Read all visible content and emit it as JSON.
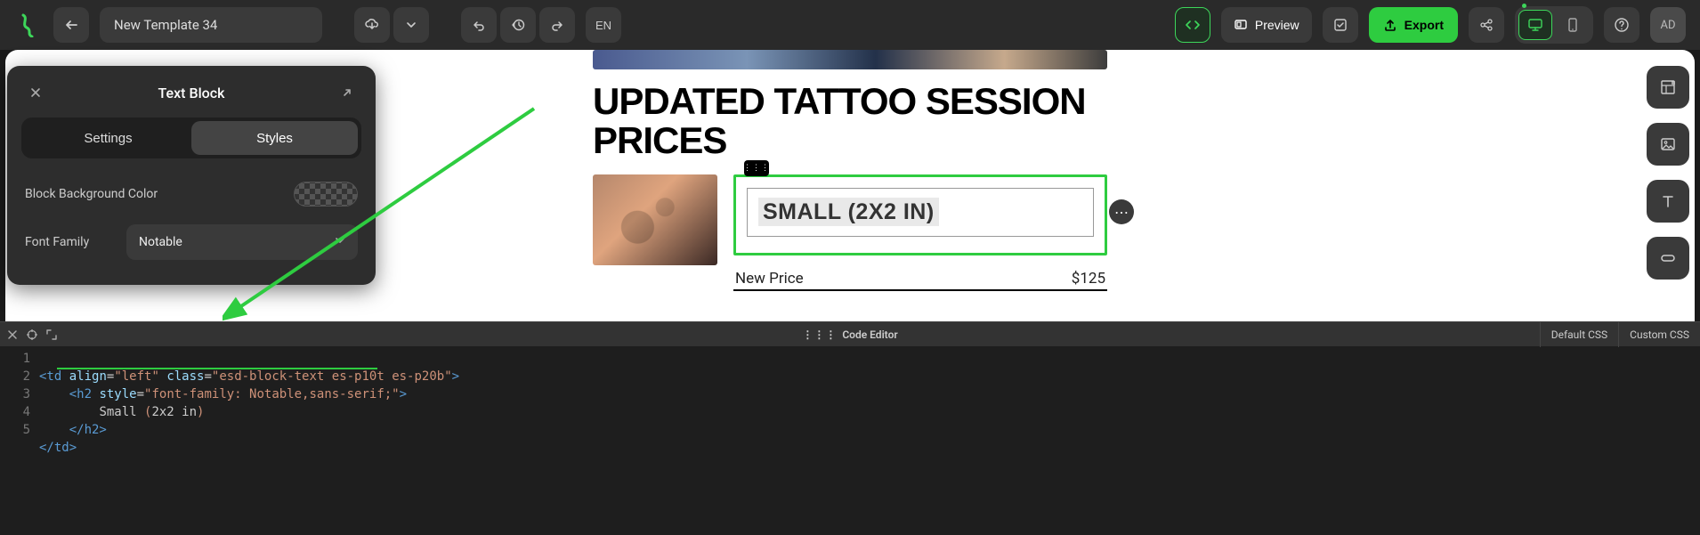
{
  "topbar": {
    "template_name": "New Template 34",
    "lang": "EN",
    "preview": "Preview",
    "export": "Export",
    "avatar": "AD"
  },
  "panel": {
    "title": "Text Block",
    "tabs": {
      "settings": "Settings",
      "styles": "Styles"
    },
    "fields": {
      "bg_label": "Block Background Color",
      "font_label": "Font Family",
      "font_value": "Notable"
    }
  },
  "canvas": {
    "headline": "UPDATED TATTOO SESSION PRICES",
    "block_title": "SMALL (2X2 IN)",
    "price_label": "New Price",
    "price_value": "$125"
  },
  "code_editor": {
    "title": "Code Editor",
    "tabs": {
      "default": "Default CSS",
      "custom": "Custom CSS"
    },
    "lines": {
      "l1": {
        "indent": "",
        "open": "<td",
        "attrs": " align=\"left\" class=\"esd-block-text es-p10t es-p20b\"",
        "close": ">"
      },
      "l2": {
        "indent": "    ",
        "open": "<h2",
        "attrs": " style=\"font-family: Notable,sans-serif;\"",
        "close": ">"
      },
      "l3": {
        "indent": "        ",
        "text": "Small (2x2 in)"
      },
      "l4": {
        "indent": "    ",
        "closing": "</h2>"
      },
      "l5": {
        "indent": "",
        "closing": "</td>"
      }
    }
  }
}
